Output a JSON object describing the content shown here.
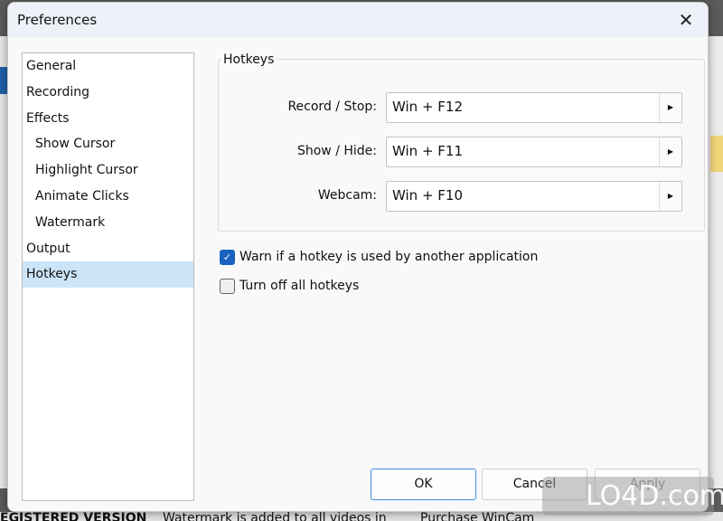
{
  "dialog": {
    "title": "Preferences",
    "close_icon": "close-icon"
  },
  "nav": {
    "items": [
      {
        "label": "General",
        "level": 0
      },
      {
        "label": "Recording",
        "level": 0
      },
      {
        "label": "Effects",
        "level": 0
      },
      {
        "label": "Show Cursor",
        "level": 1
      },
      {
        "label": "Highlight Cursor",
        "level": 1
      },
      {
        "label": "Animate Clicks",
        "level": 1
      },
      {
        "label": "Watermark",
        "level": 1
      },
      {
        "label": "Output",
        "level": 0
      },
      {
        "label": "Hotkeys",
        "level": 0,
        "selected": true
      }
    ]
  },
  "hotkeys": {
    "group_title": "Hotkeys",
    "rows": [
      {
        "label": "Record / Stop:",
        "value": "Win + F12"
      },
      {
        "label": "Show / Hide:",
        "value": "Win + F11"
      },
      {
        "label": "Webcam:",
        "value": "Win + F10"
      }
    ],
    "options": [
      {
        "label": "Warn if a hotkey is used by another application",
        "checked": true
      },
      {
        "label": "Turn off all hotkeys",
        "checked": false
      }
    ]
  },
  "buttons": {
    "ok": "OK",
    "cancel": "Cancel",
    "apply": "Apply"
  },
  "background": {
    "status_1": "EGISTERED VERSION",
    "status_2": "Watermark is added to all videos in",
    "status_3": "Purchase WinCam"
  },
  "watermark": "LO4D.com",
  "colors": {
    "accent": "#1a63c1",
    "selection": "#cce4f7"
  }
}
